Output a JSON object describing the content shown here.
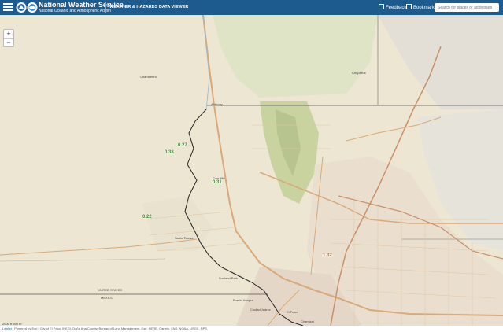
{
  "header": {
    "title": "National Weather Service",
    "subtitle": "National Oceanic and Atmospheric Admin",
    "viewer_title": "WEATHER & HAZARDS DATA VIEWER",
    "feedback": "Feedback",
    "bookmark": "Bookmark",
    "search_placeholder": "Search for places or addresses"
  },
  "map": {
    "zoom_in": "+",
    "zoom_out": "−",
    "places": {
      "chamberino": "Chamberino",
      "anthony": "Anthony",
      "chaparral": "Chaparral",
      "canutillo": "Canutillo",
      "santa_teresa": "Santa Teresa",
      "sunland_park": "Sunland Park",
      "puerto_anapra": "Puerto Anapra",
      "ciudad_juarez": "Ciudad Juárez",
      "el_paso": "El Paso",
      "chamizal": "Chamizal",
      "united_states": "UNITED STATES",
      "mexico": "MEXICO"
    },
    "observations": [
      {
        "value": "0.38",
        "color": "#3c8c2c"
      },
      {
        "value": "0.27",
        "color": "#3c8c2c"
      },
      {
        "value": "0.31",
        "color": "#3c8c2c"
      },
      {
        "value": "0.22",
        "color": "#3c8c2c"
      },
      {
        "value": "1.32",
        "color": "#d2691e"
      }
    ],
    "scale_text": "2000 ft   500 m"
  },
  "attribution": {
    "leaflet": "Leaflet",
    "text": " | Powered by Esri | City of El Paso, INEGI, Doña Ana County, Bureau of Land Management, Esri, HERE, Garmin, FAO, NOAA, USGS, NPS"
  }
}
